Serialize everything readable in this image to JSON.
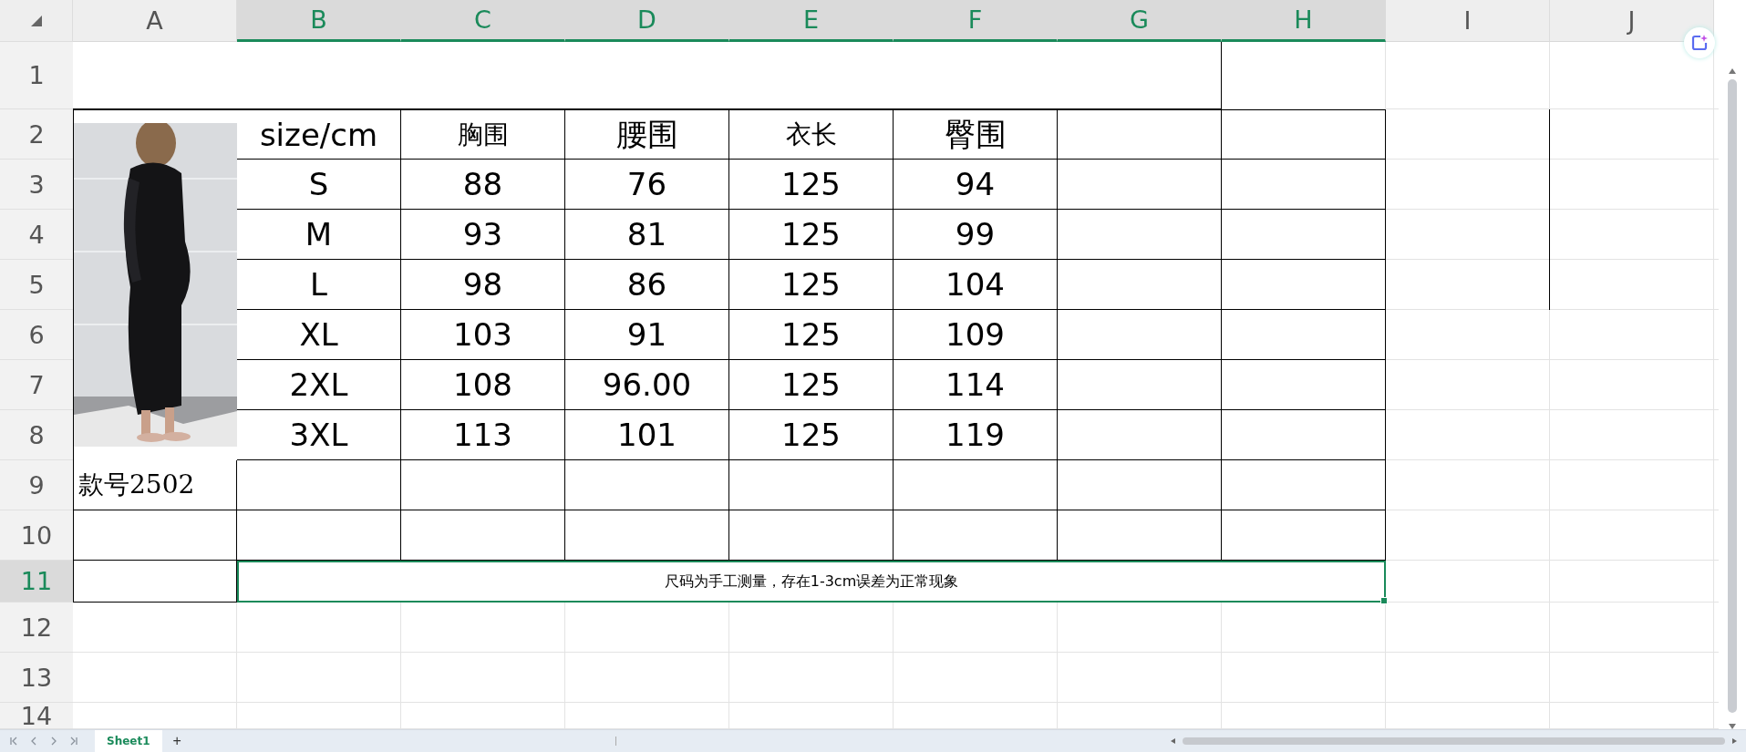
{
  "column_headers": [
    {
      "label": "A",
      "selected": false
    },
    {
      "label": "B",
      "selected": true
    },
    {
      "label": "C",
      "selected": true
    },
    {
      "label": "D",
      "selected": true
    },
    {
      "label": "E",
      "selected": true
    },
    {
      "label": "F",
      "selected": true
    },
    {
      "label": "G",
      "selected": true
    },
    {
      "label": "H",
      "selected": true
    },
    {
      "label": "I",
      "selected": false
    },
    {
      "label": "J",
      "selected": false
    }
  ],
  "row_headers": [
    {
      "label": "1",
      "selected": false
    },
    {
      "label": "2",
      "selected": false
    },
    {
      "label": "3",
      "selected": false
    },
    {
      "label": "4",
      "selected": false
    },
    {
      "label": "5",
      "selected": false
    },
    {
      "label": "6",
      "selected": false
    },
    {
      "label": "7",
      "selected": false
    },
    {
      "label": "8",
      "selected": false
    },
    {
      "label": "9",
      "selected": false
    },
    {
      "label": "10",
      "selected": false
    },
    {
      "label": "11",
      "selected": true
    },
    {
      "label": "12",
      "selected": false
    },
    {
      "label": "13",
      "selected": false
    },
    {
      "label": "14",
      "selected": false
    }
  ],
  "size_chart": {
    "header": [
      "size/cm",
      "胸围",
      "腰围",
      "衣长",
      "臀围"
    ],
    "rows": [
      [
        "S",
        "88",
        "76",
        "125",
        "94"
      ],
      [
        "M",
        "93",
        "81",
        "125",
        "99"
      ],
      [
        "L",
        "98",
        "86",
        "125",
        "104"
      ],
      [
        "XL",
        "103",
        "91",
        "125",
        "109"
      ],
      [
        "2XL",
        "108",
        "96.00",
        "125",
        "114"
      ],
      [
        "3XL",
        "113",
        "101",
        "125",
        "119"
      ]
    ]
  },
  "style_number": "款号2502",
  "note": {
    "text": "尺码为手工测量，存在1-3cm误差为正常现象",
    "selected": true
  },
  "sheet_tabs": [
    {
      "label": "Sheet1",
      "selected": true
    }
  ],
  "add_sheet": "+"
}
